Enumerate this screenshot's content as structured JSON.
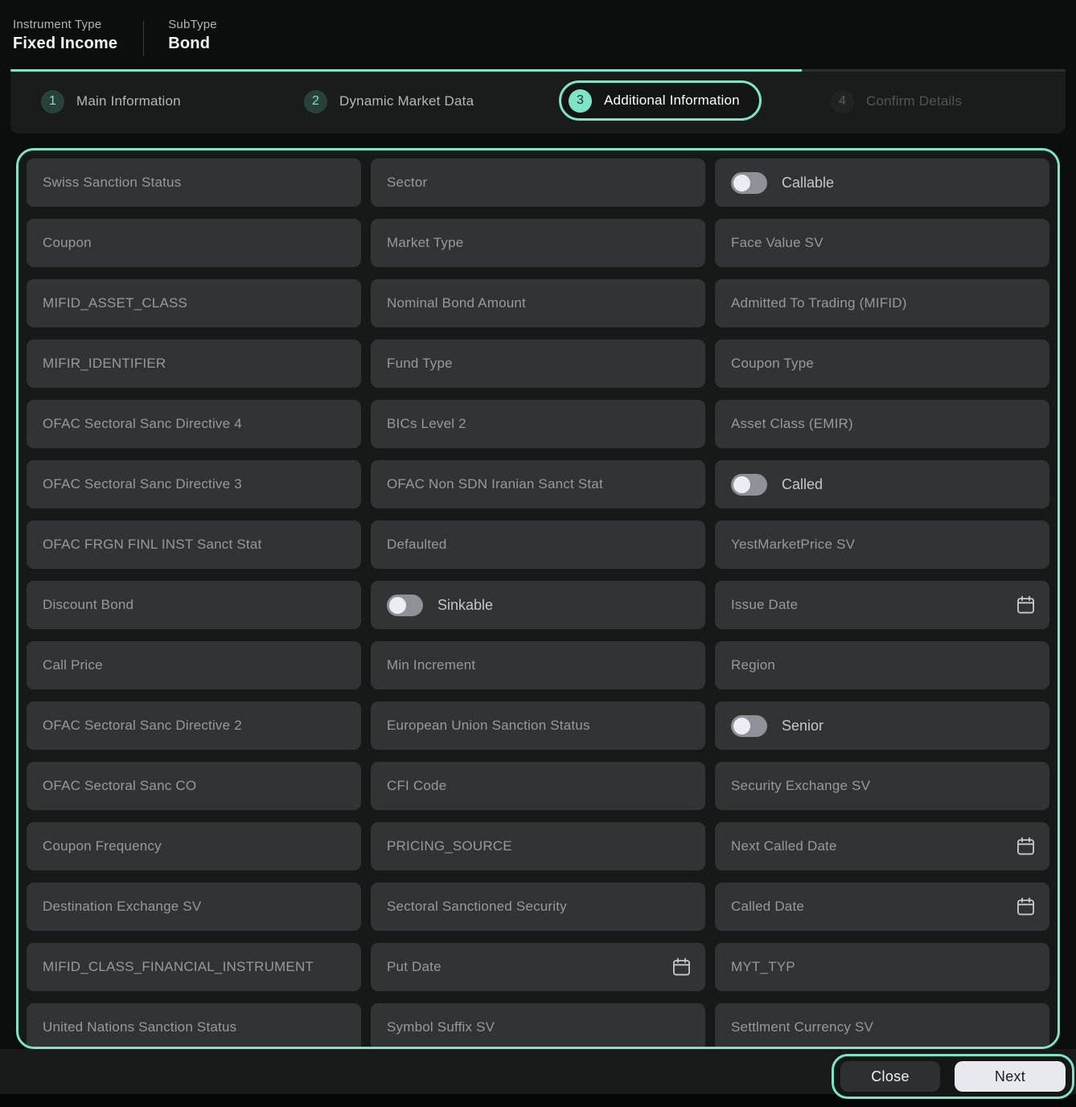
{
  "colors": {
    "accent": "#7ee3c7",
    "panel": "#1a1c1c",
    "field_bg": "#313335",
    "placeholder": "#97999c",
    "page_bg": "#0c0d0d"
  },
  "header": {
    "instrument_type_label": "Instrument Type",
    "instrument_type_value": "Fixed Income",
    "subtype_label": "SubType",
    "subtype_value": "Bond"
  },
  "stepper": {
    "progress_percent": 75,
    "steps": [
      {
        "number": "1",
        "label": "Main Information",
        "state": "done"
      },
      {
        "number": "2",
        "label": "Dynamic Market Data",
        "state": "done"
      },
      {
        "number": "3",
        "label": "Additional Information",
        "state": "active"
      },
      {
        "number": "4",
        "label": "Confirm Details",
        "state": "upcoming"
      }
    ]
  },
  "form": {
    "fields": [
      {
        "type": "input",
        "placeholder": "Swiss Sanction Status"
      },
      {
        "type": "input",
        "placeholder": "Sector"
      },
      {
        "type": "toggle",
        "label": "Callable",
        "state": "off"
      },
      {
        "type": "input",
        "placeholder": "Coupon"
      },
      {
        "type": "input",
        "placeholder": "Market Type"
      },
      {
        "type": "input",
        "placeholder": "Face Value SV"
      },
      {
        "type": "input",
        "placeholder": "MIFID_ASSET_CLASS"
      },
      {
        "type": "input",
        "placeholder": "Nominal Bond Amount"
      },
      {
        "type": "input",
        "placeholder": "Admitted To Trading (MIFID)"
      },
      {
        "type": "input",
        "placeholder": "MIFIR_IDENTIFIER"
      },
      {
        "type": "input",
        "placeholder": "Fund Type"
      },
      {
        "type": "input",
        "placeholder": "Coupon Type"
      },
      {
        "type": "input",
        "placeholder": "OFAC Sectoral Sanc Directive 4"
      },
      {
        "type": "input",
        "placeholder": "BICs Level 2"
      },
      {
        "type": "input",
        "placeholder": "Asset Class (EMIR)"
      },
      {
        "type": "input",
        "placeholder": "OFAC Sectoral Sanc Directive 3"
      },
      {
        "type": "input",
        "placeholder": "OFAC Non SDN Iranian Sanct Stat"
      },
      {
        "type": "toggle",
        "label": "Called",
        "state": "off"
      },
      {
        "type": "input",
        "placeholder": "OFAC FRGN FINL INST Sanct Stat"
      },
      {
        "type": "input",
        "placeholder": "Defaulted"
      },
      {
        "type": "input",
        "placeholder": "YestMarketPrice SV"
      },
      {
        "type": "input",
        "placeholder": "Discount Bond"
      },
      {
        "type": "toggle",
        "label": "Sinkable",
        "state": "off"
      },
      {
        "type": "date",
        "placeholder": "Issue Date"
      },
      {
        "type": "input",
        "placeholder": "Call Price"
      },
      {
        "type": "input",
        "placeholder": "Min Increment"
      },
      {
        "type": "input",
        "placeholder": "Region"
      },
      {
        "type": "input",
        "placeholder": "OFAC Sectoral Sanc Directive 2"
      },
      {
        "type": "input",
        "placeholder": "European Union Sanction Status"
      },
      {
        "type": "toggle",
        "label": "Senior",
        "state": "off"
      },
      {
        "type": "input",
        "placeholder": "OFAC Sectoral Sanc CO"
      },
      {
        "type": "input",
        "placeholder": "CFI Code"
      },
      {
        "type": "input",
        "placeholder": "Security Exchange SV"
      },
      {
        "type": "input",
        "placeholder": "Coupon Frequency"
      },
      {
        "type": "input",
        "placeholder": "PRICING_SOURCE"
      },
      {
        "type": "date",
        "placeholder": "Next Called Date"
      },
      {
        "type": "input",
        "placeholder": "Destination Exchange SV"
      },
      {
        "type": "input",
        "placeholder": "Sectoral Sanctioned Security"
      },
      {
        "type": "date",
        "placeholder": "Called Date"
      },
      {
        "type": "input",
        "placeholder": "MIFID_CLASS_FINANCIAL_INSTRUMENT"
      },
      {
        "type": "date",
        "placeholder": "Put Date"
      },
      {
        "type": "input",
        "placeholder": "MYT_TYP"
      },
      {
        "type": "input",
        "placeholder": "United Nations Sanction Status"
      },
      {
        "type": "input",
        "placeholder": "Symbol Suffix SV"
      },
      {
        "type": "input",
        "placeholder": "Settlment Currency SV"
      }
    ]
  },
  "footer": {
    "close_label": "Close",
    "next_label": "Next"
  }
}
